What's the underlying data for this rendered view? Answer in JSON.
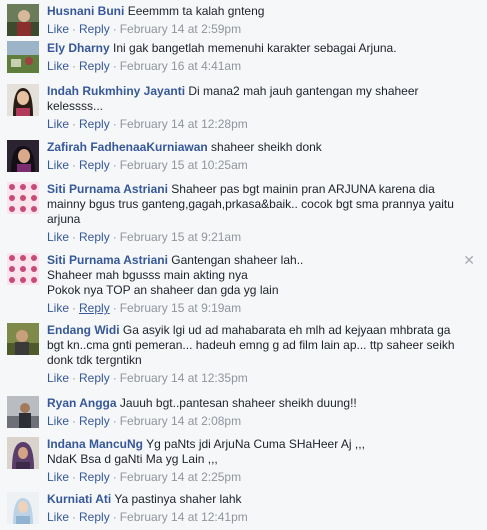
{
  "comments": [
    {
      "author": "Husnani Buni",
      "text": "Eeemmm ta kalah gnteng",
      "like": "Like",
      "reply": "Reply",
      "time": "February 14 at 2:59pm",
      "avatar": "photo-avatar-outdoor"
    },
    {
      "author": "Ely Dharny",
      "text": "Ini gak bangetlah memenuhi karakter sebagai Arjuna.",
      "like": "Like",
      "reply": "Reply",
      "time": "February 16 at 4:41am",
      "avatar": "photo-avatar-landscape"
    },
    {
      "author": "Indah Rukmhiny Jayanti",
      "text": "Di mana2 mah jauh gantengan my shaheer kelessss...",
      "like": "Like",
      "reply": "Reply",
      "time": "February 14 at 12:28pm",
      "avatar": "photo-avatar-woman"
    },
    {
      "author": "Zafirah FadhenaaKurniawan",
      "text": "shaheer sheikh donk",
      "like": "Like",
      "reply": "Reply",
      "time": "February 15 at 10:25am",
      "avatar": "photo-avatar-dark"
    },
    {
      "author": "Siti Purnama Astriani",
      "text": "Shaheer pas bgt mainin pran ARJUNA karena dia mainny bgus trus ganteng,gagah,prkasa&baik.. cocok bgt sma prannya yaitu arjuna",
      "like": "Like",
      "reply": "Reply",
      "time": "February 15 at 9:21am",
      "avatar": "pattern-avatar"
    },
    {
      "author": "Siti Purnama Astriani",
      "text": "Gantengan shaheer lah..\nShaheer mah bgusss main akting nya\nPokok nya TOP an shaheer dan gda yg lain",
      "like": "Like",
      "reply": "Reply",
      "time": "February 15 at 9:19am",
      "avatar": "pattern-avatar"
    },
    {
      "author": "Endang Widi",
      "text": "Ga asyik lgi ud ad mahabarata eh mlh ad kejyaan mhbrata ga bgt kn..cma gnti pemeran... hadeuh emng g ad film lain ap... ttp saheer seikh donk tdk tergntikn",
      "like": "Like",
      "reply": "Reply",
      "time": "February 14 at 12:35pm",
      "avatar": "photo-avatar-olive"
    },
    {
      "author": "Ryan Angga",
      "text": "Jauuh bgt..pantesan shaheer sheikh duung!!",
      "like": "Like",
      "reply": "Reply",
      "time": "February 14 at 2:08pm",
      "avatar": "photo-avatar-man"
    },
    {
      "author": "Indana MancuNg",
      "text": "Yg paNts jdi ArjuNa Cuma SHaHeer Aj ,,,\nNdaK Bsa d gaNti Ma yg Lain ,,,",
      "like": "Like",
      "reply": "Reply",
      "time": "February 14 at 2:25pm",
      "avatar": "photo-avatar-hijab"
    },
    {
      "author": "Kurniati Ati",
      "text": "Ya pastinya shaher lahk",
      "like": "Like",
      "reply": "Reply",
      "time": "February 14 at 12:41pm",
      "avatar": "photo-avatar-light"
    }
  ],
  "close_symbol": "✕",
  "colors": {
    "link": "#365899",
    "meta": "#90949c",
    "text": "#1d2129",
    "background": "#f6f7f9"
  }
}
